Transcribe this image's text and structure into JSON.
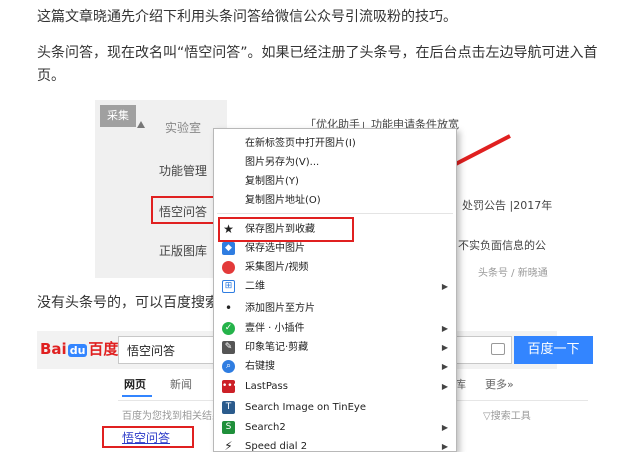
{
  "article": {
    "para1": "这篇文章晓通先介绍下利用头条问答给微信公众号引流吸粉的技巧。",
    "para2_line1": "头条问答，现在改名叫“悟空问答”。如果已经注册了头条号，在后台点击左边导航可进入首",
    "para2_line2": "页。",
    "para3": "没有头条号的，可以百度搜索"
  },
  "screenshot1": {
    "collect_badge": "采集",
    "sidebar": [
      "实验室",
      "功能管理",
      "悟空问答",
      "正版图库"
    ],
    "right_texts": [
      "「优化助手」功能申请条件放宽",
      "处罚公告 |2017年",
      "不实负面信息的公",
      "头条号 / 新晓通"
    ]
  },
  "screenshot2": {
    "logo_text": "Bai",
    "logo_text2": "百度",
    "search_value": "悟空问答",
    "search_button": "百度一下",
    "tabs": [
      "网页",
      "新闻",
      "库",
      "更多»"
    ],
    "result_hint": "百度为您找到相关结果",
    "search_tools": "搜索工具",
    "result_title": "悟空问答"
  },
  "context_menu": {
    "items": [
      {
        "label": "在新标签页中打开图片(I)",
        "icon": "",
        "arrow": false
      },
      {
        "label": "图片另存为(V)...",
        "icon": "",
        "arrow": false
      },
      {
        "label": "复制图片(Y)",
        "icon": "",
        "arrow": false
      },
      {
        "label": "复制图片地址(O)",
        "icon": "",
        "arrow": false
      },
      {
        "label": "保存图片到收藏",
        "icon": "star-icon",
        "arrow": false
      },
      {
        "label": "保存选中图片",
        "icon": "save-selected-icon",
        "arrow": false
      },
      {
        "label": "采集图片/视频",
        "icon": "collect-icon",
        "arrow": false
      },
      {
        "label": "二维",
        "icon": "qr-code-icon",
        "arrow": true
      },
      {
        "label": "添加图片至方片",
        "icon": "dot-icon",
        "arrow": false
      },
      {
        "label": "壹伴 · 小插件",
        "icon": "yiban-icon",
        "arrow": true
      },
      {
        "label": "印象笔记·剪藏",
        "icon": "evernote-icon",
        "arrow": true
      },
      {
        "label": "右键搜",
        "icon": "search-icon",
        "arrow": true
      },
      {
        "label": "LastPass",
        "icon": "lastpass-icon",
        "arrow": true
      },
      {
        "label": "Search Image on TinEye",
        "icon": "tineye-icon",
        "arrow": false
      },
      {
        "label": "Search2",
        "icon": "search2-icon",
        "arrow": true
      },
      {
        "label": "Speed dial 2",
        "icon": "speed-dial-icon",
        "arrow": true
      }
    ]
  },
  "colors": {
    "highlight": "#e02020",
    "baidu_blue": "#3385ff",
    "baidu_red": "#e02020"
  }
}
